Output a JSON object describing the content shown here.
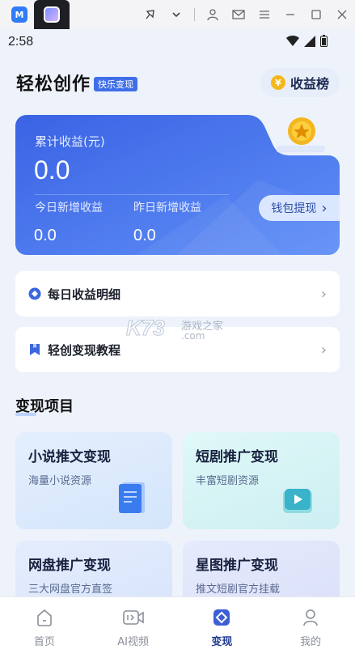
{
  "emulator": {
    "logo_text": "M",
    "icons": [
      "pin-icon",
      "chevron-down-icon",
      "account-icon",
      "mail-icon",
      "menu-icon",
      "minimize-icon",
      "maximize-icon",
      "close-icon"
    ]
  },
  "status_bar": {
    "time": "2:58",
    "icons": [
      "wifi-icon",
      "signal-icon",
      "battery-icon"
    ]
  },
  "header": {
    "title": "轻松创作",
    "badge": "快乐变现",
    "rank_button": {
      "coin_symbol": "¥",
      "label": "收益榜"
    }
  },
  "earnings": {
    "total_label": "累计收益(元)",
    "total_value": "0.0",
    "today_label": "今日新增收益",
    "today_value": "0.0",
    "yesterday_label": "昨日新增收益",
    "yesterday_value": "0.0",
    "withdraw_label": "钱包提现",
    "withdraw_chevron": "›"
  },
  "menu_rows": [
    {
      "label": "每日收益明细",
      "icon": "diamond-icon",
      "chevron": "›"
    },
    {
      "label": "轻创变现教程",
      "icon": "bookmark-icon",
      "chevron": "›"
    }
  ],
  "watermark": {
    "brand": "K73",
    "text": "游戏之家",
    "domain": ".com"
  },
  "section": {
    "title": "变现项目"
  },
  "projects": [
    {
      "title": "小说推文变现",
      "subtitle": "海量小说资源",
      "icon": "document-icon",
      "bg": "#dceafc"
    },
    {
      "title": "短剧推广变现",
      "subtitle": "丰富短剧资源",
      "icon": "play-icon",
      "bg": "#d7f4f6"
    },
    {
      "title": "网盘推广变现",
      "subtitle": "三大网盘官方直签",
      "icon": "cloud-icon",
      "bg": "#e0eafc"
    },
    {
      "title": "星图推广变现",
      "subtitle": "推文短剧官方挂载",
      "icon": "star-icon",
      "bg": "#e3e8fb"
    }
  ],
  "bottom_nav": [
    {
      "label": "首页",
      "icon": "home-icon",
      "active": false
    },
    {
      "label": "AI视频",
      "icon": "ai-video-icon",
      "active": false
    },
    {
      "label": "变现",
      "icon": "monetize-icon",
      "active": true
    },
    {
      "label": "我的",
      "icon": "profile-icon",
      "active": false
    }
  ],
  "colors": {
    "accent": "#3f6ee8",
    "card_gradient_start": "#3d66e6",
    "card_gradient_end": "#5d8cf6",
    "gold": "#f5b81c",
    "active_nav": "#1f3b8f"
  }
}
